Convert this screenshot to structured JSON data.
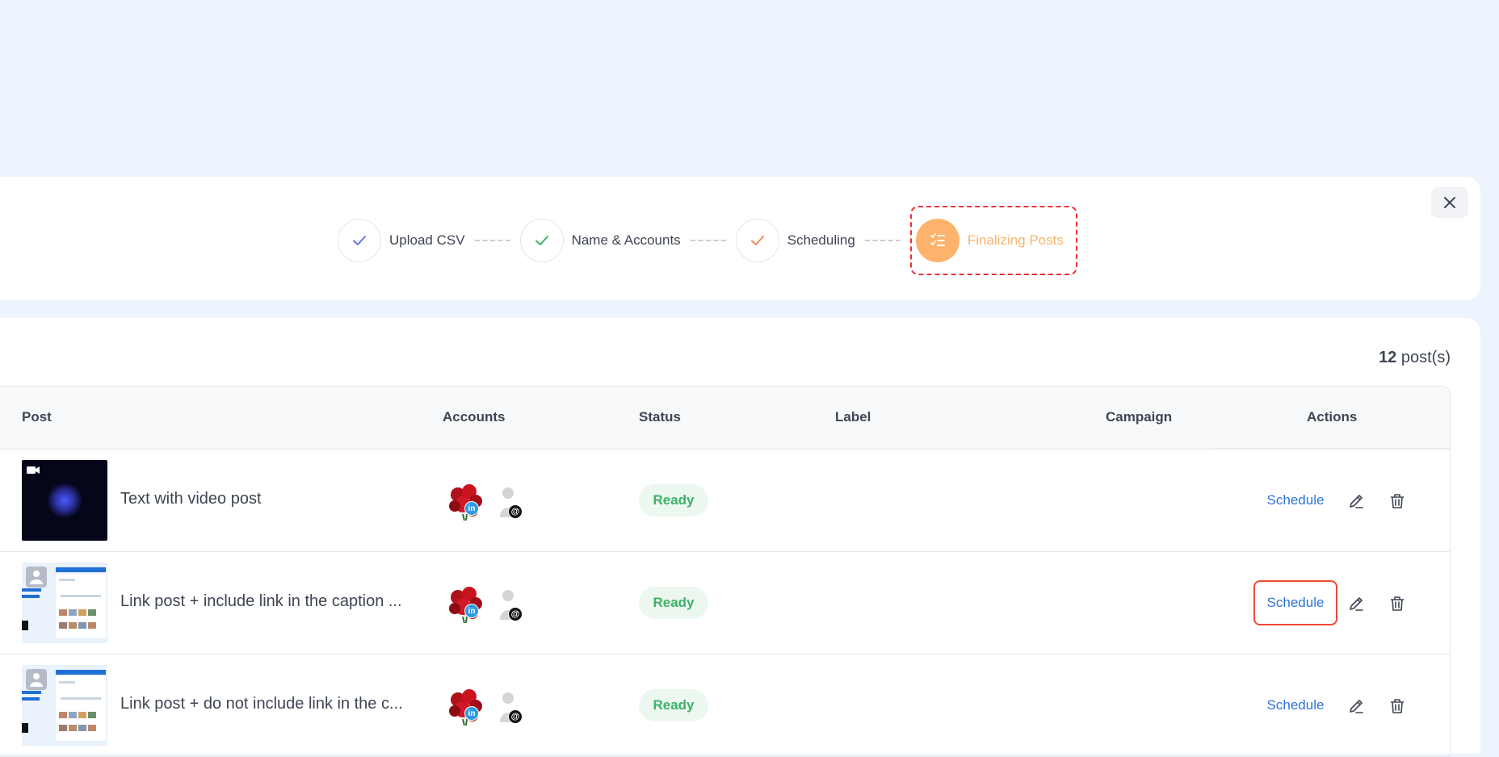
{
  "stepper": {
    "steps": [
      {
        "label": "Upload CSV",
        "check_color": "#6574e8"
      },
      {
        "label": "Name & Accounts",
        "check_color": "#3cb267"
      },
      {
        "label": "Scheduling",
        "check_color": "#f08b5a"
      },
      {
        "label": "Finalizing Posts",
        "active_color": "#fdb36b"
      }
    ]
  },
  "close_icon": "close-icon",
  "post_count": {
    "number": "12",
    "suffix": "post(s)"
  },
  "table": {
    "headers": {
      "post": "Post",
      "accounts": "Accounts",
      "status": "Status",
      "label": "Label",
      "campaign": "Campaign",
      "actions": "Actions"
    },
    "rows": [
      {
        "post": "Text with video post",
        "status": "Ready",
        "label": "",
        "campaign": "",
        "schedule": "Schedule",
        "thumb": "video"
      },
      {
        "post": "Link post + include link in the caption ...",
        "status": "Ready",
        "label": "",
        "campaign": "",
        "schedule": "Schedule",
        "thumb": "link"
      },
      {
        "post": "Link post + do not include link in the c...",
        "status": "Ready",
        "label": "",
        "campaign": "",
        "schedule": "Schedule",
        "thumb": "link"
      }
    ]
  },
  "colors": {
    "background": "#eef4fd",
    "ready_text": "#3cb267",
    "ready_bg": "#ecf7ef",
    "schedule_link": "#2f73d9",
    "highlight_border": "#ee4a34",
    "active_step_border": "#e8333b"
  }
}
